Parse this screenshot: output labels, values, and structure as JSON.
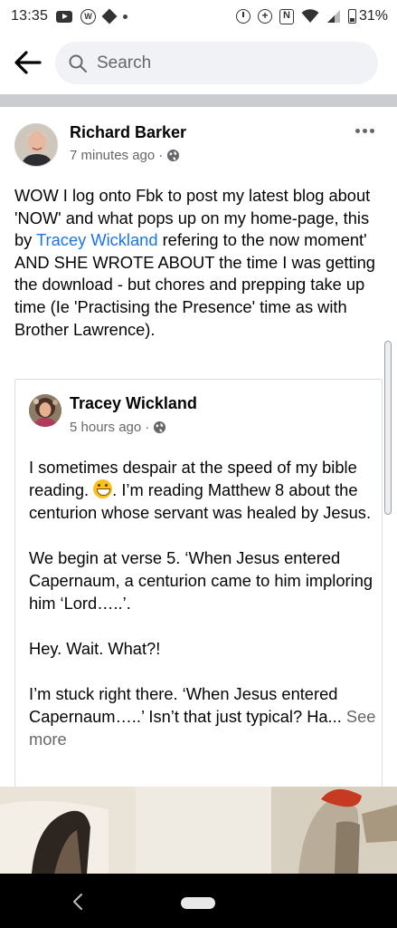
{
  "status_bar": {
    "time": "13:35",
    "battery_percent": "31%",
    "icons": [
      "youtube-icon",
      "wordpress-icon",
      "diamond-icon",
      "dot-icon",
      "alarm-icon",
      "data-saver-icon",
      "nfc-icon",
      "wifi-icon",
      "signal-icon",
      "battery-icon"
    ]
  },
  "search": {
    "placeholder": "Search"
  },
  "post": {
    "author": "Richard Barker",
    "time": "7 minutes ago",
    "separator": "·",
    "text_before_mention": "WOW I log onto Fbk to post my latest blog about 'NOW' and what pops up on my home-page, this by ",
    "mention": "Tracey Wickland",
    "text_after_mention": " refering to the now moment' AND SHE WROTE ABOUT the time I was getting the download - but chores and prepping take up time (Ie 'Practising the Presence' time as with Brother Lawrence)."
  },
  "shared_post": {
    "author": "Tracey Wickland",
    "time": "5 hours ago",
    "separator": "·",
    "para1_before_emoji": "I sometimes despair at the speed of my bible reading. ",
    "para1_after_emoji": ".   I’m reading Matthew 8 about the centurion whose servant was healed by Jesus.",
    "para2": "We begin at verse 5.  ‘When Jesus entered Capernaum, a centurion came to him imploring him ‘Lord…..’.",
    "para3": "Hey. Wait. What?!",
    "para4": "I’m stuck right there.  ‘When Jesus entered Capernaum…..’ Isn’t that just typical?   Ha...",
    "see_more": " See more"
  }
}
